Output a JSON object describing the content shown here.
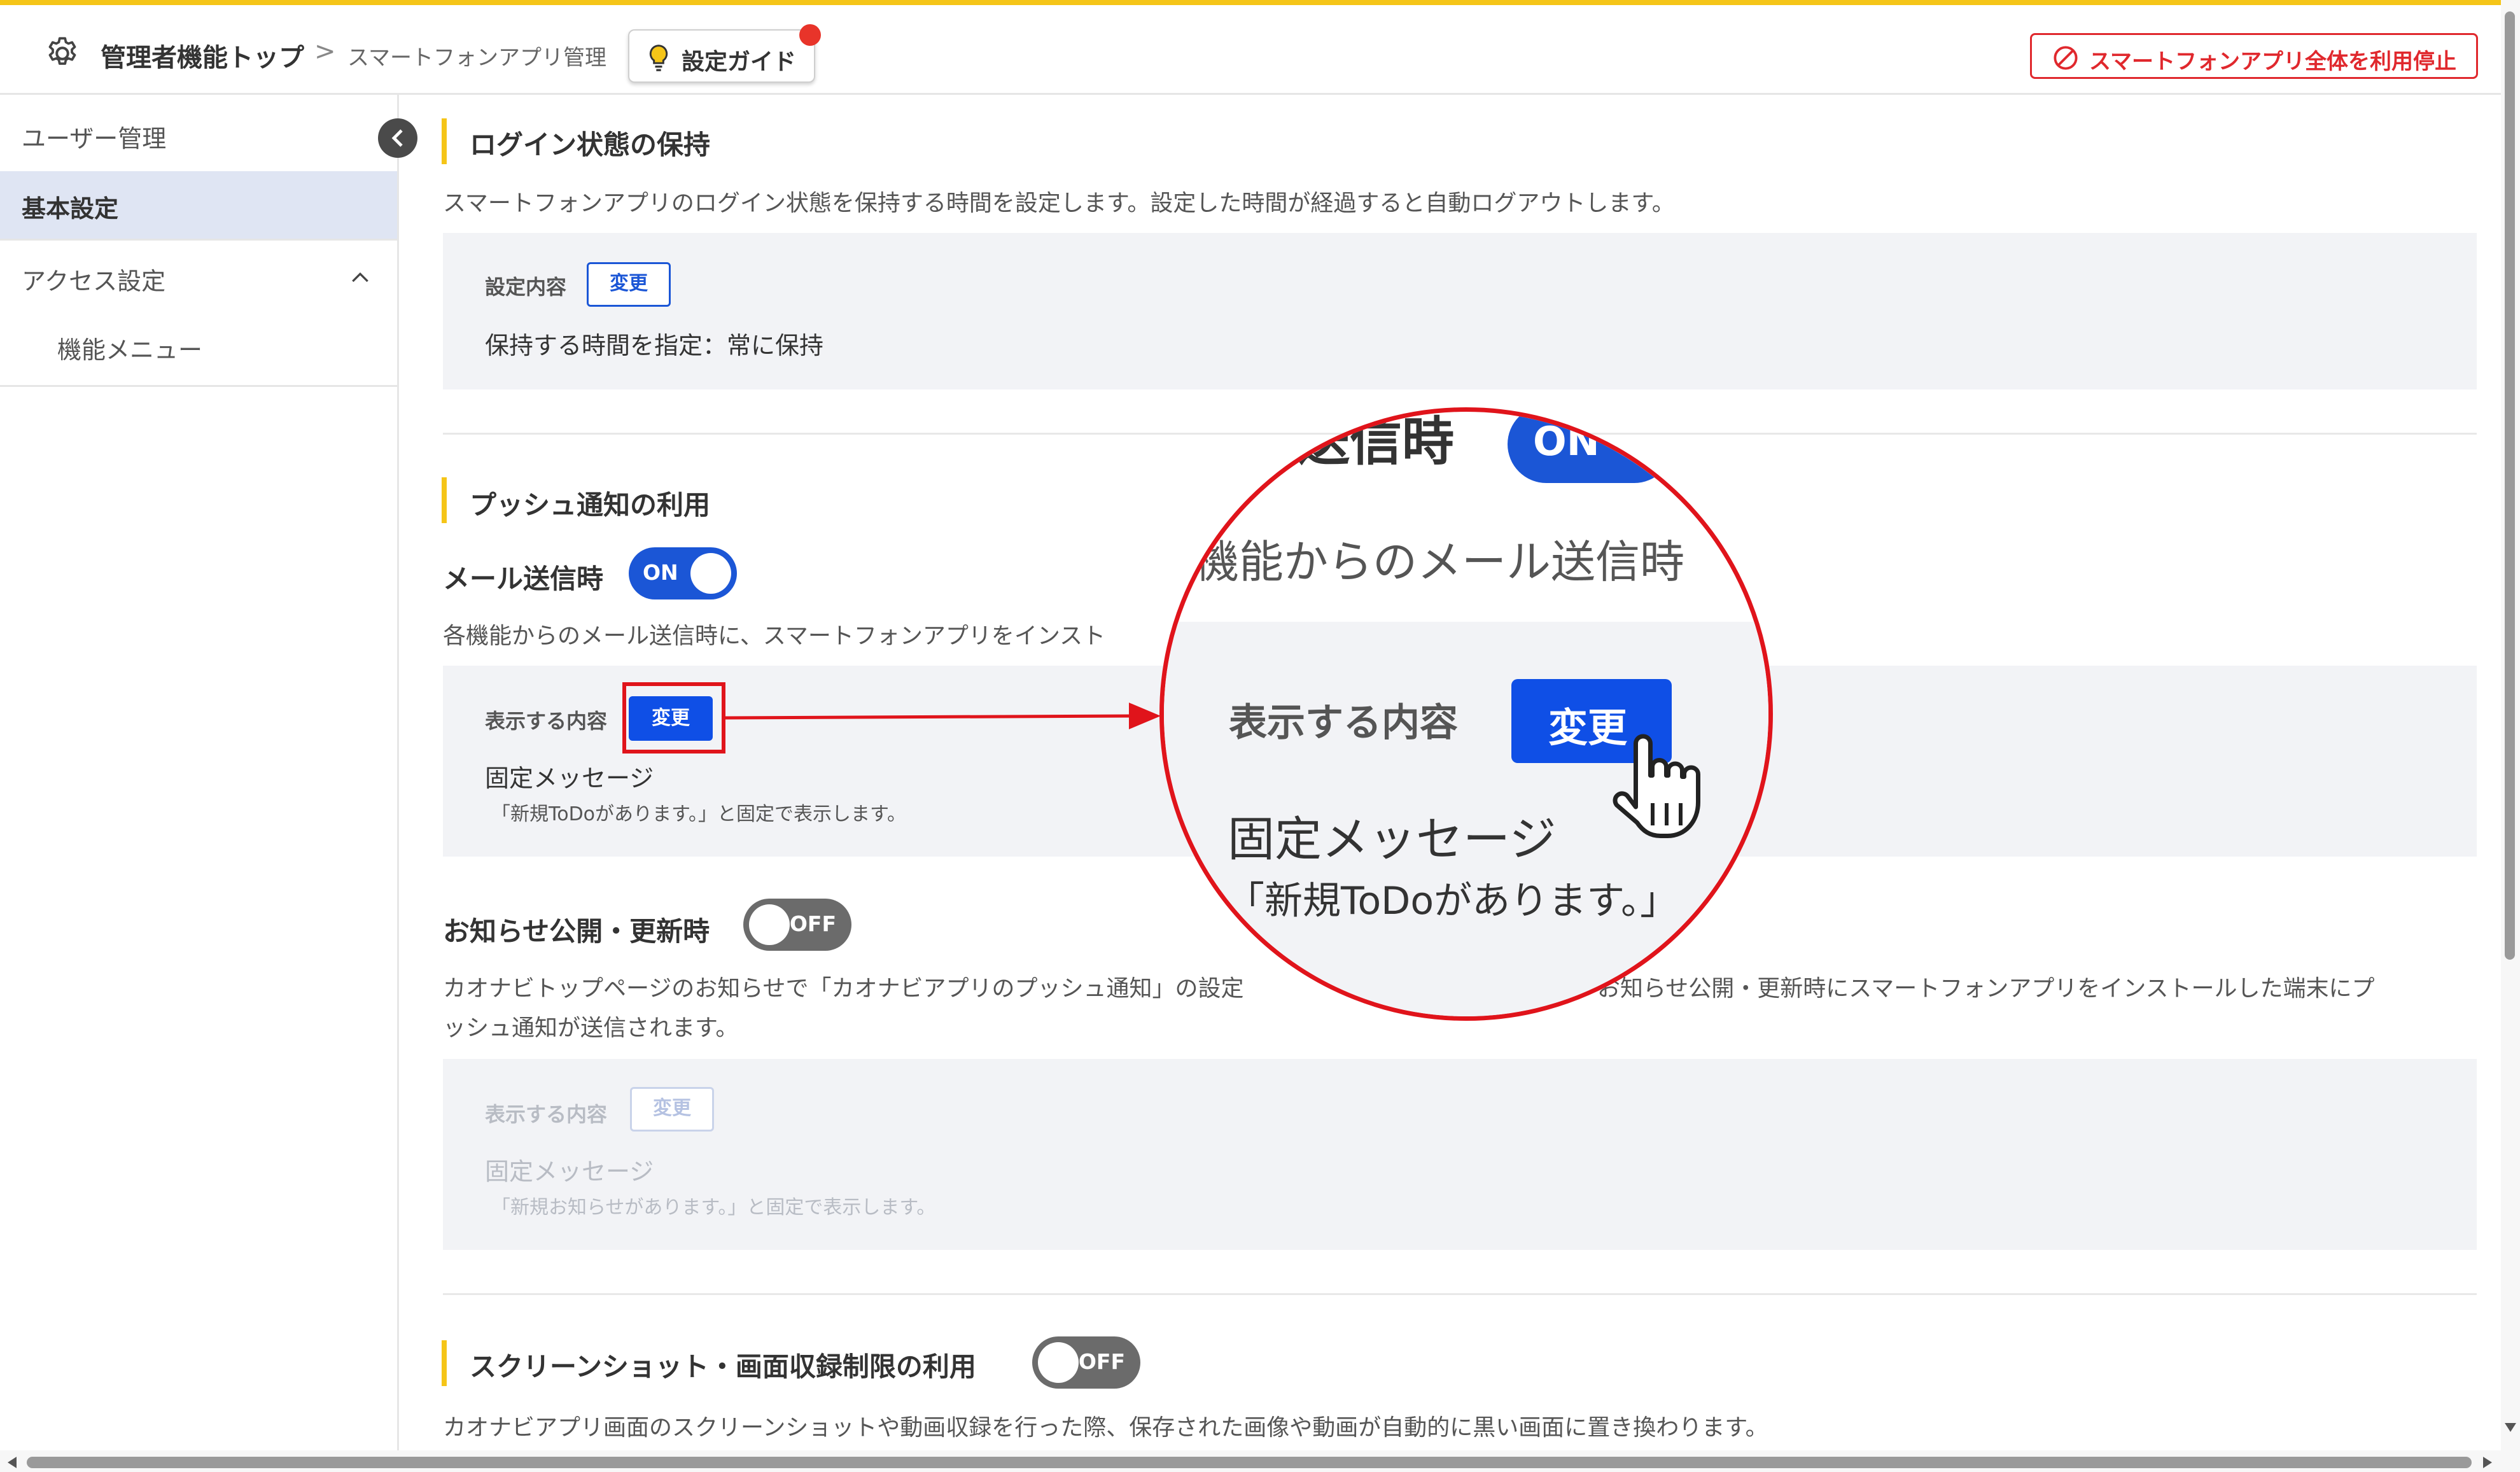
{
  "header": {
    "title": "管理者機能トップ",
    "separator": ">",
    "breadcrumb": "スマートフォンアプリ管理",
    "guide_button": "設定ガイド",
    "stop_button": "スマートフォンアプリ全体を利用停止"
  },
  "sidebar": {
    "items": [
      {
        "label": "ユーザー管理"
      },
      {
        "label": "基本設定",
        "selected": true
      },
      {
        "label": "アクセス設定",
        "expanded": true
      },
      {
        "label": "機能メニュー"
      }
    ]
  },
  "sections": {
    "login": {
      "title": "ログイン状態の保持",
      "description": "スマートフォンアプリのログイン状態を保持する時間を設定します。設定した時間が経過すると自動ログアウトします。",
      "label": "設定内容",
      "change_button": "変更",
      "value": "保持する時間を指定：常に保持"
    },
    "push": {
      "title": "プッシュ通知の利用",
      "mail": {
        "title": "メール送信時",
        "toggle": "ON",
        "description": "各機能からのメール送信時に、スマートフォンアプリをインスト",
        "label": "表示する内容",
        "change_button": "変更",
        "value": "固定メッセージ",
        "note": "「新規ToDoがあります。」と固定で表示します。"
      },
      "news": {
        "title": "お知らせ公開・更新時",
        "toggle": "OFF",
        "description_line1_a": "カオナビトップページのお知らせで「カオナビアプリのプッシュ通知」の設定",
        "description_line1_b": "お知らせ公開・更新時にスマートフォンアプリをインストールした端末にプ",
        "description_line2": "ッシュ通知が送信されます。",
        "label": "表示する内容",
        "change_button": "変更",
        "value": "固定メッセージ",
        "note": "「新規お知らせがあります。」と固定で表示します。"
      }
    },
    "screenshot": {
      "title": "スクリーンショット・画面収録制限の利用",
      "toggle": "OFF",
      "description": "カオナビアプリ画面のスクリーンショットや動画収録を行った際、保存された画像や動画が自動的に黒い画面に置き換わります。"
    }
  },
  "magnifier": {
    "title": "送信時",
    "toggle": "ON",
    "description": "機能からのメール送信時",
    "label": "表示する内容",
    "change_button": "変更",
    "value": "固定メッセージ",
    "note": "「新規ToDoがあります。」"
  },
  "colors": {
    "accent_yellow": "#f5c518",
    "primary_blue": "#1b56d6",
    "danger_red": "#e0282d",
    "highlight_red": "#e0141b"
  }
}
